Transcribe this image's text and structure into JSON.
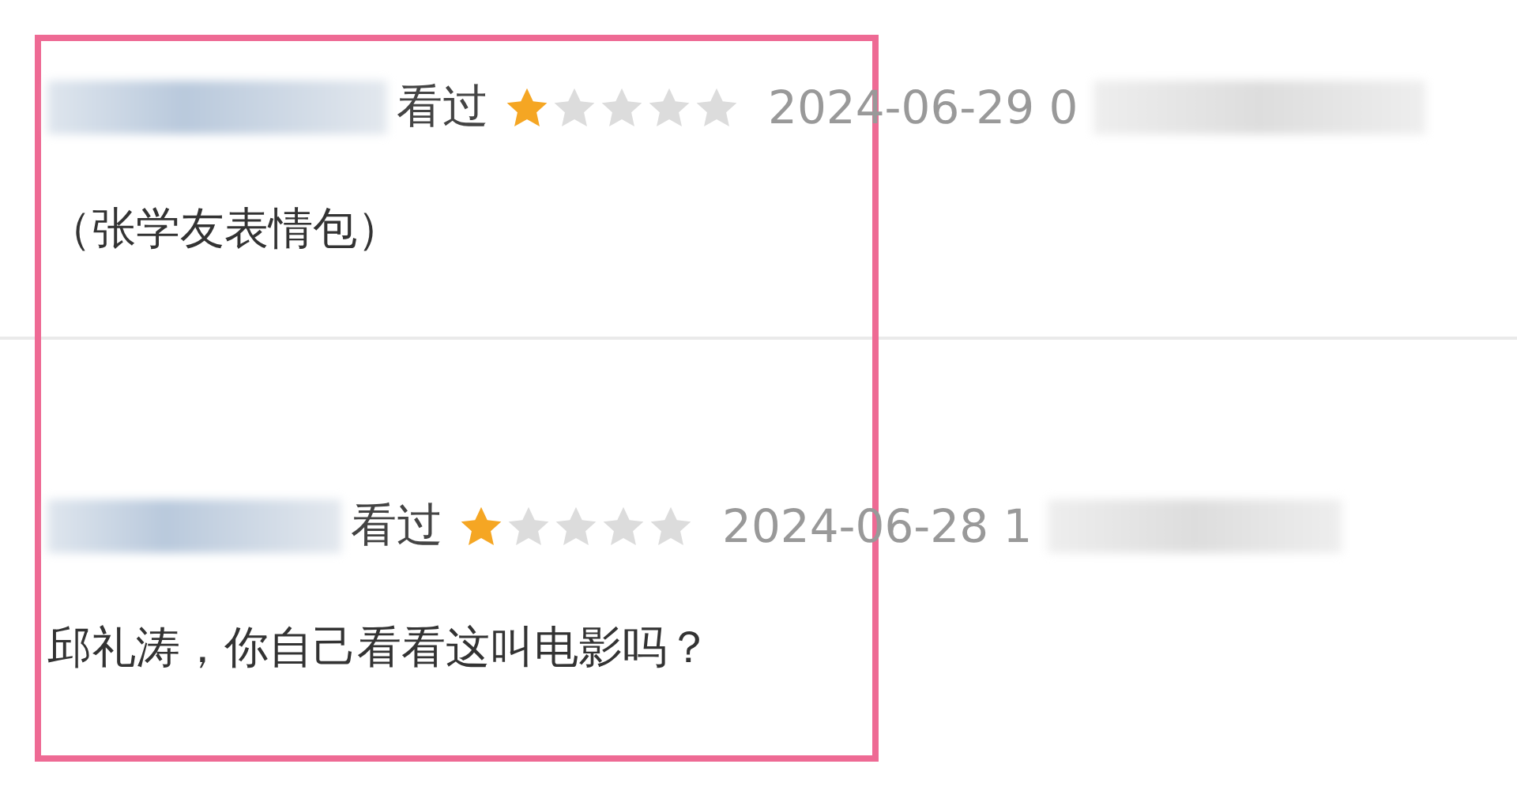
{
  "highlight": {
    "shown": true
  },
  "reviews": [
    {
      "status": "看过",
      "stars": 1,
      "time": "2024-06-29 0",
      "comment": "（张学友表情包）"
    },
    {
      "status": "看过",
      "stars": 1,
      "time": "2024-06-28 1",
      "comment": "邱礼涛，你自己看看这叫电影吗？"
    }
  ]
}
